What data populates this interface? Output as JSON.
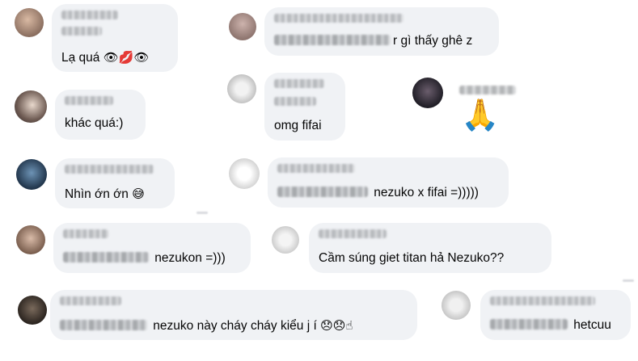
{
  "comments": [
    {
      "id": "c1",
      "text": "Lạ quá ",
      "emoji": "👁💋👁",
      "avatar_color": "#b89a86"
    },
    {
      "id": "c2",
      "suffix": "r gì thấy ghê z",
      "avatar_color": "#a98c86"
    },
    {
      "id": "c3",
      "text": "khác quá:)",
      "avatar_color": "#8b7a72"
    },
    {
      "id": "c4",
      "text": "omg fifai",
      "avatar_color": "#c7c7c7"
    },
    {
      "id": "c5",
      "emoji": "🙏",
      "avatar_color": "#2c2a34"
    },
    {
      "id": "c6",
      "text": "Nhìn ớn ớn ",
      "emoji": "😅",
      "avatar_color": "#3a5f7a"
    },
    {
      "id": "c7",
      "suffix": " nezuko x fifai =)))))",
      "avatar_color": "#d4d4d4"
    },
    {
      "id": "c8",
      "suffix": " nezukon =)))",
      "avatar_color": "#9e8270"
    },
    {
      "id": "c9",
      "text": "Cầm súng giet titan hả Nezuko??",
      "avatar_color": "#cfcfcf"
    },
    {
      "id": "c10",
      "suffix": " nezuko này cháy cháy kiểu j í ",
      "emoji": "😞😞☝",
      "avatar_color": "#4b4038"
    },
    {
      "id": "c11",
      "suffix": " hetcuu",
      "avatar_color": "#c9c9c9"
    }
  ]
}
